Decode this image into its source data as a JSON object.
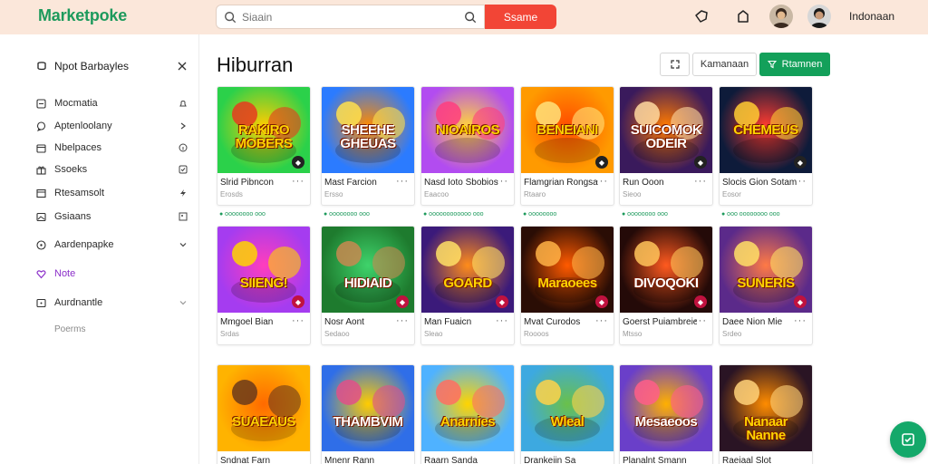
{
  "header": {
    "logo": "Marketpoke",
    "search_placeholder": "Siaain",
    "search_button": "Ssame",
    "language": "Indonaan"
  },
  "sidebar": {
    "title": "Npot Barbayles",
    "items": [
      {
        "label": "Mocmatia"
      },
      {
        "label": "Aptenloolany"
      },
      {
        "label": "Nbelpaces"
      },
      {
        "label": "Ssoeks"
      },
      {
        "label": "Rtesamsolt"
      },
      {
        "label": "Gsiaans"
      },
      {
        "label": "Aardenpapke"
      },
      {
        "label": "Note"
      },
      {
        "label": "Aurdnantle"
      }
    ],
    "sub_label": "Poerms",
    "colors": {
      "active": "#8b2fc9"
    }
  },
  "main": {
    "title": "Hiburran",
    "toolbar": {
      "secondary_label": "Kamanaan",
      "primary_label": "Rtamnen"
    },
    "rows": [
      [
        {
          "art": "RAKIRO MOBERS",
          "name": "Slrid Pibncon",
          "sub": "Erosds",
          "tag": "● oooooooo ooo"
        },
        {
          "art": "SHEEHE GHEUAS",
          "name": "Mast Farcion",
          "sub": "Ersso",
          "tag": "● oooooooo ooo"
        },
        {
          "art": "NIOAIROS",
          "name": "Nasd Ioto Sbobios.",
          "sub": "Eaacoo",
          "tag": "● oooooooooooo ooo"
        },
        {
          "art": "BENEIANI",
          "name": "Flamgrian Rongsan",
          "sub": "Rtaaro",
          "tag": "● oooooooo"
        },
        {
          "art": "SUICOMOK ODEIR",
          "name": "Run Ooon",
          "sub": "Sieoo",
          "tag": "● oooooooo ooo"
        },
        {
          "art": "CHEMEUS",
          "name": "Slocis Gion Sotam",
          "sub": "Eosor",
          "tag": "● ooo oooooooo ooo"
        }
      ],
      [
        {
          "art": "SIIENG!",
          "name": "Mmgoel Bian",
          "sub": "Srdas",
          "tag": ""
        },
        {
          "art": "HIDIAID",
          "name": "Nosr Aont",
          "sub": "Sedaoo",
          "tag": ""
        },
        {
          "art": "GOARD",
          "name": "Man Fuaicn",
          "sub": "Sleao",
          "tag": ""
        },
        {
          "art": "Maraoees",
          "name": "Mvat Curodos",
          "sub": "Roooos",
          "tag": ""
        },
        {
          "art": "DIVOQOKI",
          "name": "Goerst Puiambreiec",
          "sub": "Mtsso",
          "tag": ""
        },
        {
          "art": "SUNERIS",
          "name": "Daee Nion Mie",
          "sub": "Srdeo",
          "tag": ""
        }
      ],
      [
        {
          "art": "SUAEAUS",
          "name": "Sndnat Farn",
          "sub": "",
          "tag": ""
        },
        {
          "art": "THAMBVIM",
          "name": "Mnenr Rann",
          "sub": "",
          "tag": ""
        },
        {
          "art": "Anarnies",
          "name": "Raarn Sanda",
          "sub": "",
          "tag": ""
        },
        {
          "art": "Wleal",
          "name": "Drankeiin Sa",
          "sub": "",
          "tag": ""
        },
        {
          "art": "Mesaeoos",
          "name": "Planalnt Smann",
          "sub": "",
          "tag": ""
        },
        {
          "art": "Nanaar Nanne",
          "name": "Raeiaal Slot",
          "sub": "",
          "tag": ""
        }
      ]
    ]
  }
}
